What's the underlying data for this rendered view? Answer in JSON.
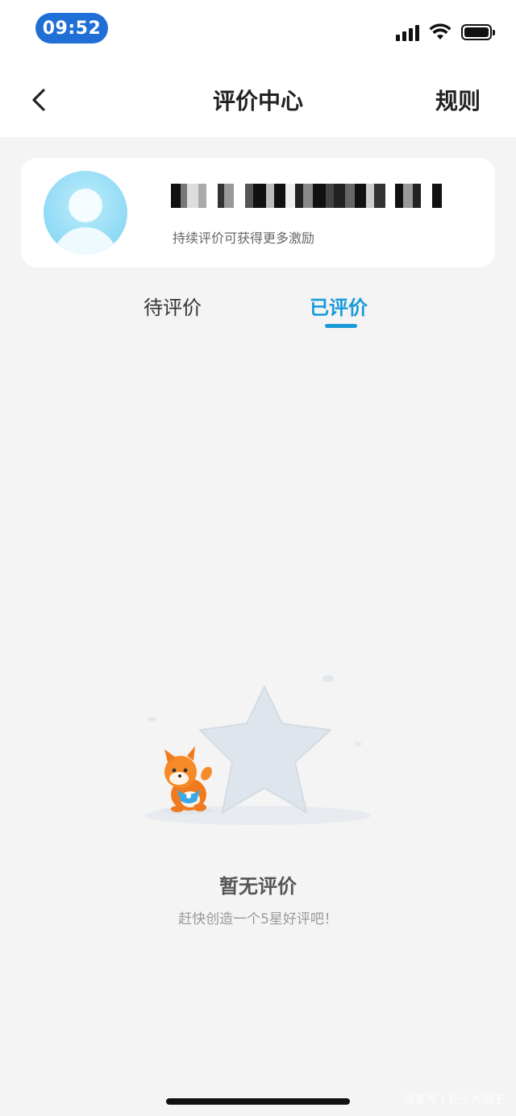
{
  "status_bar": {
    "time": "09:52",
    "icons": [
      "signal-icon",
      "wifi-icon",
      "battery-icon"
    ]
  },
  "nav": {
    "back_icon": "chevron-left-icon",
    "title": "评价中心",
    "rules_label": "规则"
  },
  "profile": {
    "avatar_icon": "default-avatar-icon",
    "username_pixelated": true,
    "subtitle": "持续评价可获得更多激励"
  },
  "tabs": [
    {
      "label": "待评价",
      "active": false
    },
    {
      "label": "已评价",
      "active": true
    }
  ],
  "colors": {
    "accent": "#1a9ad8",
    "time_pill": "#1f6fd6",
    "background": "#f4f4f4"
  },
  "empty_state": {
    "illustration": "star-with-mascot-illustration",
    "title": "暂无评价",
    "subtitle": "赶快创造一个5星好评吧！"
  },
  "watermark": "百家号 / 狂少大胡子"
}
